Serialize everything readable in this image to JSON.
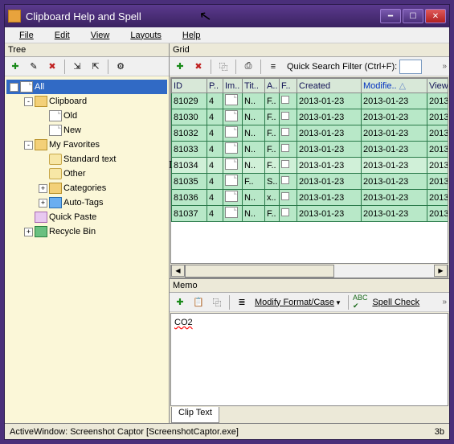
{
  "title": "Clipboard Help and Spell",
  "menu": {
    "file": "File",
    "edit": "Edit",
    "view": "View",
    "layouts": "Layouts",
    "help": "Help"
  },
  "panes": {
    "tree": "Tree",
    "grid": "Grid",
    "memo": "Memo"
  },
  "tree": {
    "items": [
      {
        "indent": 0,
        "expand": "-",
        "icon": "page",
        "label": "All",
        "selected": true
      },
      {
        "indent": 1,
        "expand": "-",
        "icon": "fold",
        "label": "Clipboard"
      },
      {
        "indent": 2,
        "expand": "",
        "icon": "page",
        "label": "Old"
      },
      {
        "indent": 2,
        "expand": "",
        "icon": "page",
        "label": "New"
      },
      {
        "indent": 1,
        "expand": "-",
        "icon": "fold",
        "label": "My Favorites"
      },
      {
        "indent": 2,
        "expand": "",
        "icon": "foldclr",
        "label": "Standard text"
      },
      {
        "indent": 2,
        "expand": "",
        "icon": "foldclr",
        "label": "Other"
      },
      {
        "indent": 2,
        "expand": "+",
        "icon": "fold",
        "label": "Categories"
      },
      {
        "indent": 2,
        "expand": "+",
        "icon": "tag",
        "label": "Auto-Tags"
      },
      {
        "indent": 1,
        "expand": "",
        "icon": "paste",
        "label": "Quick Paste"
      },
      {
        "indent": 1,
        "expand": "+",
        "icon": "recycle",
        "label": "Recycle Bin"
      }
    ]
  },
  "gridtb": {
    "quicksearch": "Quick Search Filter (Ctrl+F):"
  },
  "grid": {
    "cols": [
      "ID",
      "P..",
      "Im..",
      "Tit..",
      "A..",
      "F..",
      "Created",
      "Modifie..",
      "View.."
    ],
    "rows": [
      {
        "id": "81029",
        "p": "4",
        "tit": "N..",
        "a": "F..",
        "cr": "2013-01-23",
        "md": "2013-01-23",
        "vw": "2013"
      },
      {
        "id": "81030",
        "p": "4",
        "tit": "N..",
        "a": "F..",
        "cr": "2013-01-23",
        "md": "2013-01-23",
        "vw": "2013"
      },
      {
        "id": "81032",
        "p": "4",
        "tit": "N..",
        "a": "F..",
        "cr": "2013-01-23",
        "md": "2013-01-23",
        "vw": "2013"
      },
      {
        "id": "81033",
        "p": "4",
        "tit": "N..",
        "a": "F..",
        "cr": "2013-01-23",
        "md": "2013-01-23",
        "vw": "2013"
      },
      {
        "id": "81034",
        "p": "4",
        "tit": "N..",
        "a": "F..",
        "cr": "2013-01-23",
        "md": "2013-01-23",
        "vw": "2013",
        "cur": true
      },
      {
        "id": "81035",
        "p": "4",
        "tit": "F..",
        "a": "S..",
        "cr": "2013-01-23",
        "md": "2013-01-23",
        "vw": "2013"
      },
      {
        "id": "81036",
        "p": "4",
        "tit": "N..",
        "a": "x..",
        "cr": "2013-01-23",
        "md": "2013-01-23",
        "vw": "2013"
      },
      {
        "id": "81037",
        "p": "4",
        "tit": "N..",
        "a": "F..",
        "cr": "2013-01-23",
        "md": "2013-01-23",
        "vw": "2013"
      }
    ]
  },
  "memotb": {
    "modifyformat": "Modify Format/Case",
    "spellcheck": "Spell Check"
  },
  "memo": {
    "text": "CO2"
  },
  "tabs": {
    "cliptext": "Clip Text"
  },
  "status": {
    "left": "ActiveWindow: Screenshot Captor [ScreenshotCaptor.exe]",
    "right": "3b"
  }
}
